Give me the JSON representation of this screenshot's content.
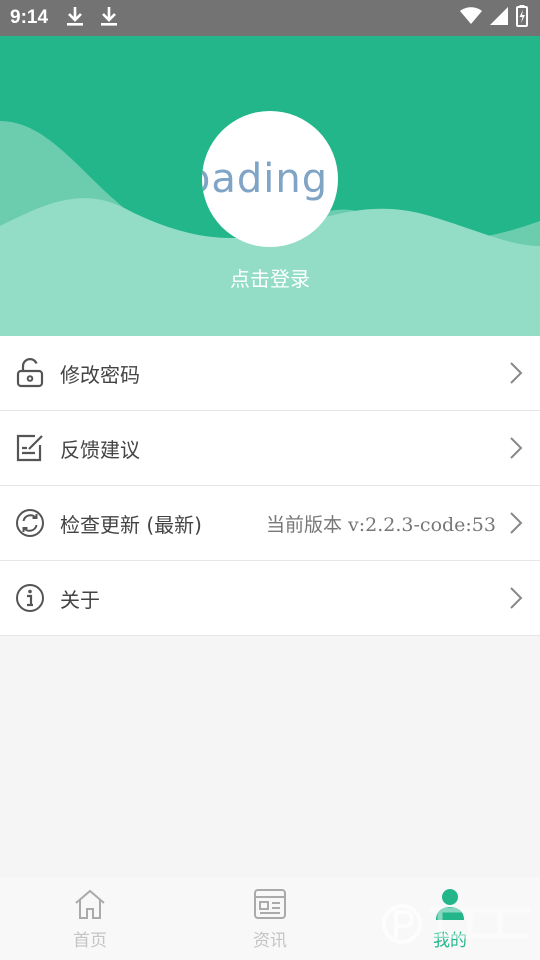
{
  "status_bar": {
    "time": "9:14",
    "icons": [
      "download-icon",
      "download-icon",
      "wifi-icon",
      "signal-icon",
      "battery-icon"
    ]
  },
  "profile": {
    "avatar_text": "oading",
    "login_label": "点击登录"
  },
  "menu": {
    "items": [
      {
        "icon": "unlock-icon",
        "label": "修改密码",
        "value": ""
      },
      {
        "icon": "edit-note-icon",
        "label": "反馈建议",
        "value": ""
      },
      {
        "icon": "refresh-icon",
        "label": "检查更新 (最新)",
        "value": "当前版本  v:2.2.3-code:53"
      },
      {
        "icon": "info-icon",
        "label": "关于",
        "value": ""
      }
    ]
  },
  "bottom_nav": {
    "tabs": [
      {
        "icon": "home-icon",
        "label": "首页"
      },
      {
        "icon": "news-icon",
        "label": "资讯"
      },
      {
        "icon": "user-icon",
        "label": "我的"
      }
    ],
    "active": "我的"
  },
  "colors": {
    "accent": "#22b68a",
    "status_bar": "#737373"
  }
}
